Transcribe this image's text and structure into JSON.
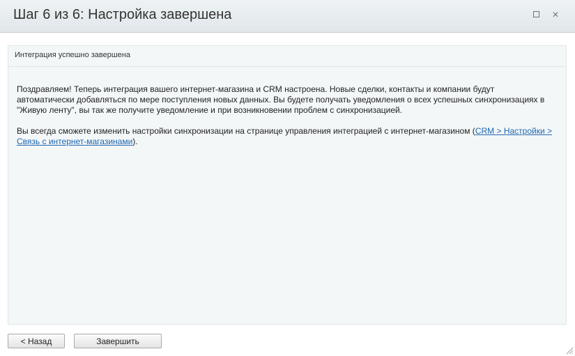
{
  "dialog": {
    "title": "Шаг 6 из 6: Настройка завершена",
    "maximize_icon": "maximize-icon",
    "close_glyph": "×"
  },
  "panel": {
    "header": "Интеграция успешно завершена",
    "paragraph1": "Поздравляем! Теперь интеграция вашего интернет-магазина и CRM настроена. Новые сделки, контакты и компании будут автоматически добавляться по мере поступления новых данных. Вы будете получать уведомления о всех успешных синхронизациях в \"Живую ленту\", вы так же получите уведомление и при возникновении проблем с синхронизацией.",
    "paragraph2_before": "Вы всегда сможете изменить настройки синхронизации на странице управления интеграцией с интернет-магазином (",
    "paragraph2_link": "CRM > Настройки > Связь с интернет-магазинами",
    "paragraph2_after": ").",
    "link_color": "#2067b0"
  },
  "buttons": {
    "back": "< Назад",
    "finish": "Завершить"
  }
}
